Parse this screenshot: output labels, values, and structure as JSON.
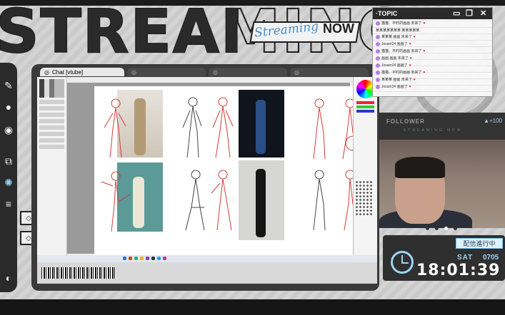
{
  "overlay": {
    "title": "STREAMING",
    "tag_script": "Streaming",
    "tag_now": "NOW"
  },
  "browser": {
    "tabs": [
      {
        "label": "Chat [vtube]"
      },
      {
        "label": ""
      },
      {
        "label": ""
      },
      {
        "label": ""
      }
    ]
  },
  "chat": {
    "title": "·TOPIC",
    "messages": [
      {
        "text": "猫猫、平时的画画 未来了"
      },
      {
        "text": "某某某某某某某 某某某某某"
      },
      {
        "text": "某某某 画画 未来了"
      },
      {
        "text": "Josam24 画画了"
      },
      {
        "text": "猫猫、平时的画画 未来了"
      },
      {
        "text": "画画 画画 未来了"
      },
      {
        "text": "Josam24 画画了"
      },
      {
        "text": "猫猫、平时的画画 未来了"
      },
      {
        "text": "某某某 画画 未来了"
      },
      {
        "text": "Josam24 画画了"
      }
    ]
  },
  "follower": {
    "label": "FOLLOWER",
    "count": "▲+100",
    "sub": "STREAMING NOW"
  },
  "clock": {
    "status": "配信進行中",
    "day": "SAT",
    "date": "0705",
    "time": "18:01:39"
  },
  "colors": {
    "accent": "#9bd3f3",
    "dark": "#2a2a2a",
    "stroke": "#d43b3b"
  }
}
